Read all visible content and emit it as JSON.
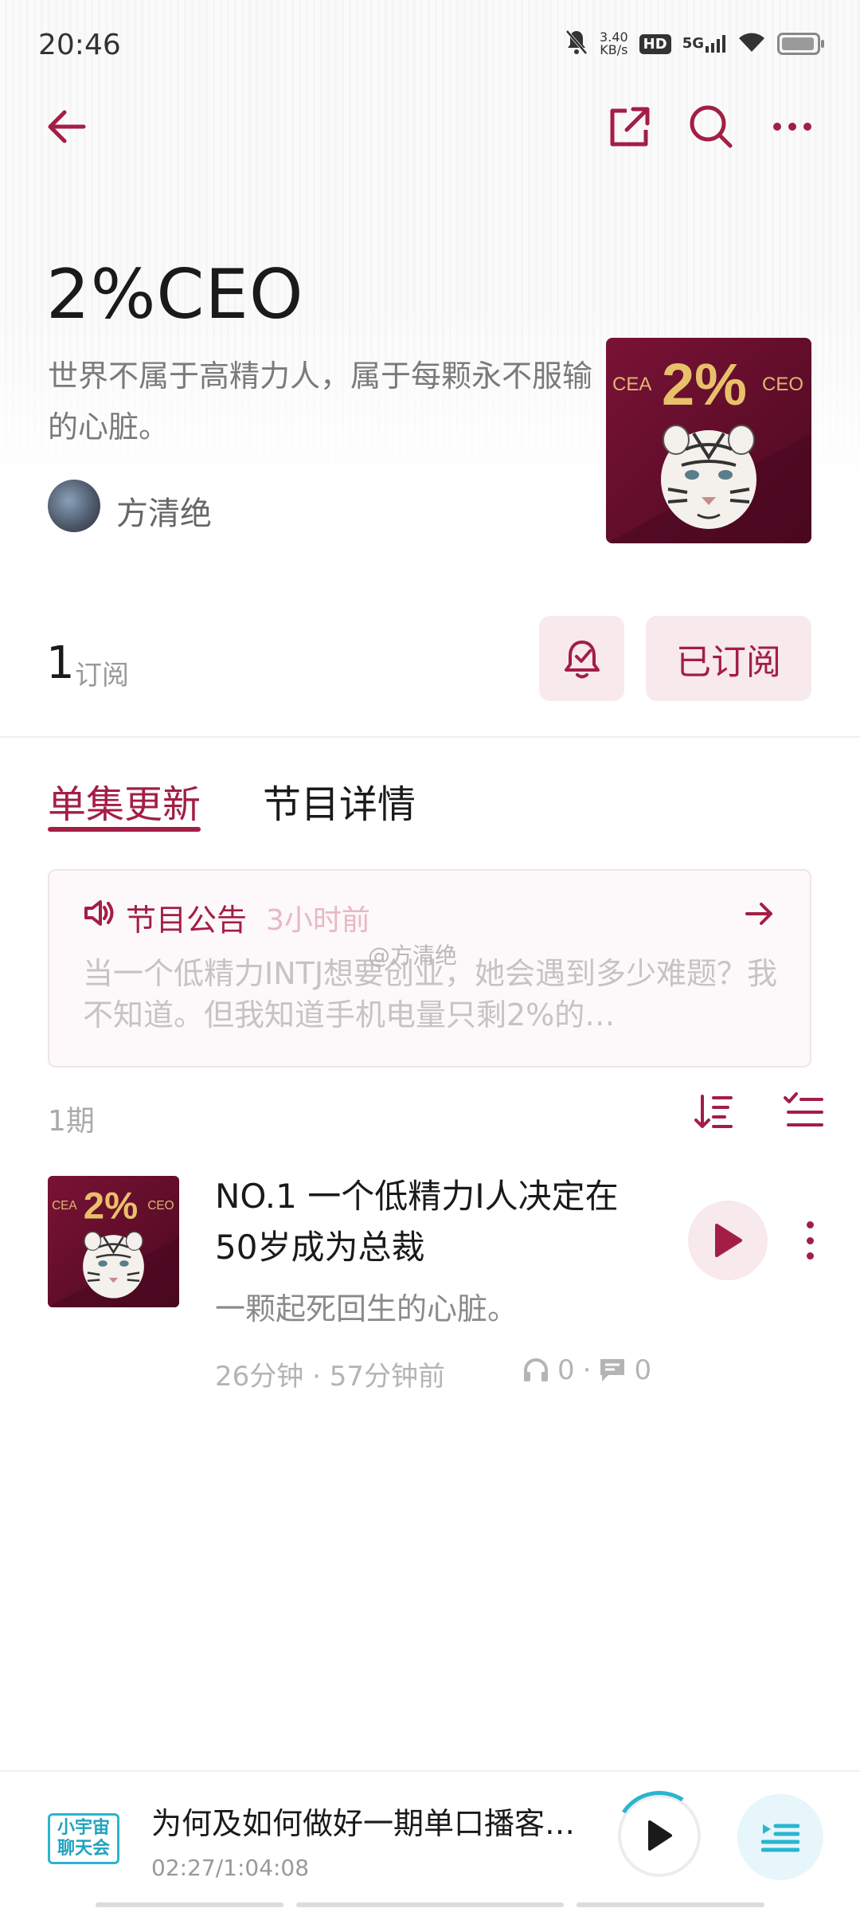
{
  "status_bar": {
    "time": "20:46",
    "net_speed_value": "3.40",
    "net_speed_unit": "KB/s",
    "hd": "HD",
    "network": "5G",
    "battery_level": 0.95
  },
  "podcast": {
    "title": "2%CEO",
    "description": "世界不属于高精力人，属于每颗永不服输的心脏。",
    "author": "方清绝",
    "cover": {
      "left": "CEA",
      "center": "2%",
      "right": "CEO"
    }
  },
  "subscription": {
    "count": "1",
    "count_label": "订阅",
    "subscribed_label": "已订阅"
  },
  "tabs": [
    {
      "label": "单集更新",
      "active": true
    },
    {
      "label": "节目详情",
      "active": false
    }
  ],
  "announcement": {
    "title": "节目公告",
    "time": "3小时前",
    "body": "当一个低精力INTJ想要创业，她会遇到多少难题？我不知道。但我知道手机电量只剩2%的…",
    "watermark": "@方清绝"
  },
  "episode_list": {
    "count_label": "1期",
    "episodes": [
      {
        "title": "NO.1 一个低精力I人决定在50岁成为总裁",
        "subtitle": "一颗起死回生的心脏。",
        "duration": "26分钟",
        "published": "57分钟前",
        "plays": "0",
        "comments": "0"
      }
    ]
  },
  "mini_player": {
    "cover_text_line1": "小宇宙",
    "cover_text_line2": "聊天会",
    "title": "为何及如何做好一期单口播客…",
    "time": "02:27/1:04:08",
    "progress": 0.038
  },
  "colors": {
    "accent": "#a31e45",
    "accent_light": "#f7e9ec",
    "player_accent": "#2ab5cf"
  }
}
